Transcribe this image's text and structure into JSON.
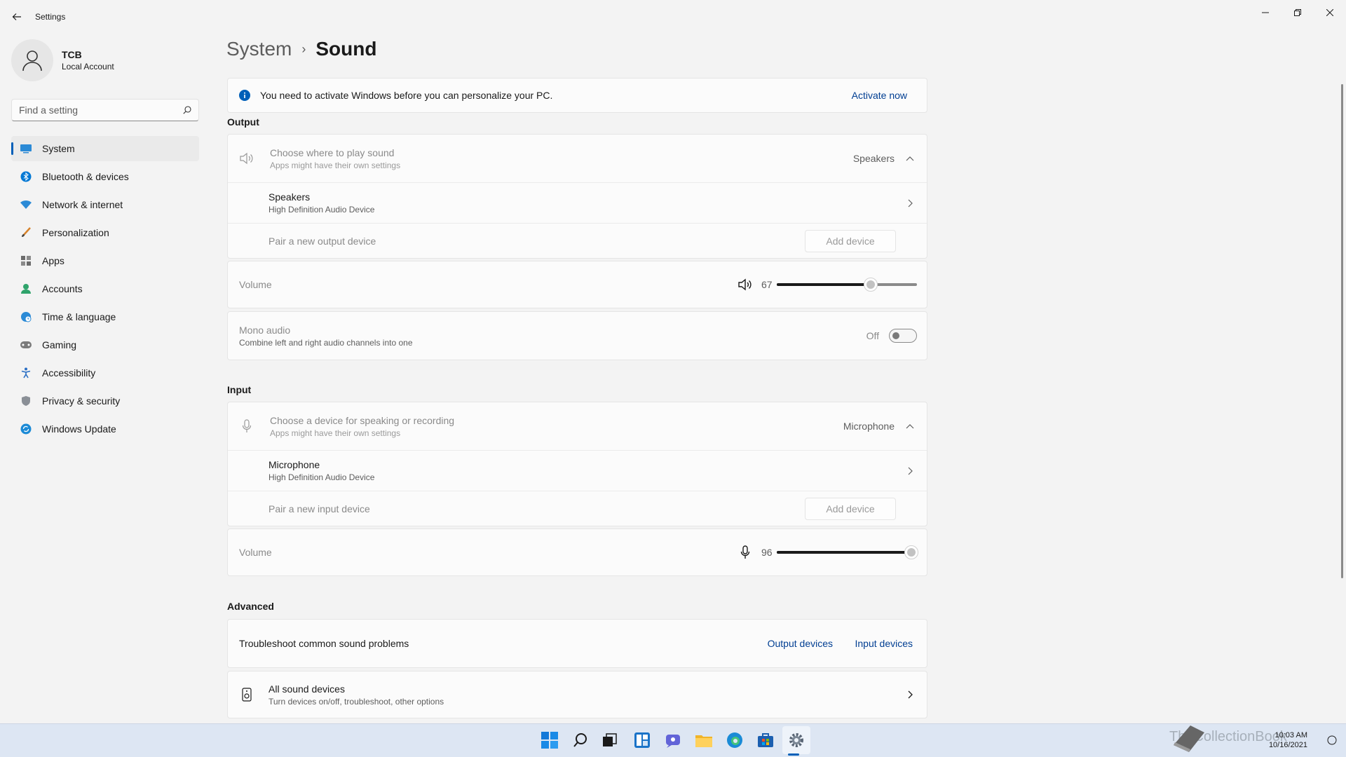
{
  "app": {
    "title": "Settings"
  },
  "profile": {
    "name": "TCB",
    "account_type": "Local Account"
  },
  "search": {
    "placeholder": "Find a setting"
  },
  "sidebar": {
    "items": [
      {
        "label": "System",
        "icon": "monitor-icon",
        "active": true
      },
      {
        "label": "Bluetooth & devices",
        "icon": "bluetooth-icon"
      },
      {
        "label": "Network & internet",
        "icon": "wifi-icon"
      },
      {
        "label": "Personalization",
        "icon": "brush-icon"
      },
      {
        "label": "Apps",
        "icon": "apps-icon"
      },
      {
        "label": "Accounts",
        "icon": "person-icon"
      },
      {
        "label": "Time & language",
        "icon": "globe-clock-icon"
      },
      {
        "label": "Gaming",
        "icon": "gamepad-icon"
      },
      {
        "label": "Accessibility",
        "icon": "accessibility-icon"
      },
      {
        "label": "Privacy & security",
        "icon": "shield-icon"
      },
      {
        "label": "Windows Update",
        "icon": "update-icon"
      }
    ]
  },
  "breadcrumb": {
    "parent": "System",
    "separator": "›",
    "current": "Sound"
  },
  "banner": {
    "text": "You need to activate Windows before you can personalize your PC.",
    "action": "Activate now"
  },
  "output": {
    "heading": "Output",
    "choose_title": "Choose where to play sound",
    "choose_sub": "Apps might have their own settings",
    "selected": "Speakers",
    "device_name": "Speakers",
    "device_sub": "High Definition Audio Device",
    "pair_label": "Pair a new output device",
    "add_button": "Add device",
    "volume_label": "Volume",
    "volume_value": "67",
    "volume_level": 67,
    "mono_title": "Mono audio",
    "mono_sub": "Combine left and right audio channels into one",
    "mono_state": "Off"
  },
  "input": {
    "heading": "Input",
    "choose_title": "Choose a device for speaking or recording",
    "choose_sub": "Apps might have their own settings",
    "selected": "Microphone",
    "device_name": "Microphone",
    "device_sub": "High Definition Audio Device",
    "pair_label": "Pair a new input device",
    "add_button": "Add device",
    "volume_label": "Volume",
    "volume_value": "96",
    "volume_level": 96
  },
  "advanced": {
    "heading": "Advanced",
    "troubleshoot_label": "Troubleshoot common sound problems",
    "output_link": "Output devices",
    "input_link": "Input devices",
    "all_devices_title": "All sound devices",
    "all_devices_sub": "Turn devices on/off, troubleshoot, other options"
  },
  "taskbar": {
    "time": "10:03 AM",
    "date": "10/16/2021",
    "watermark": "TheCollectionBook"
  },
  "colors": {
    "accent": "#005fb8",
    "link": "#003e92"
  }
}
